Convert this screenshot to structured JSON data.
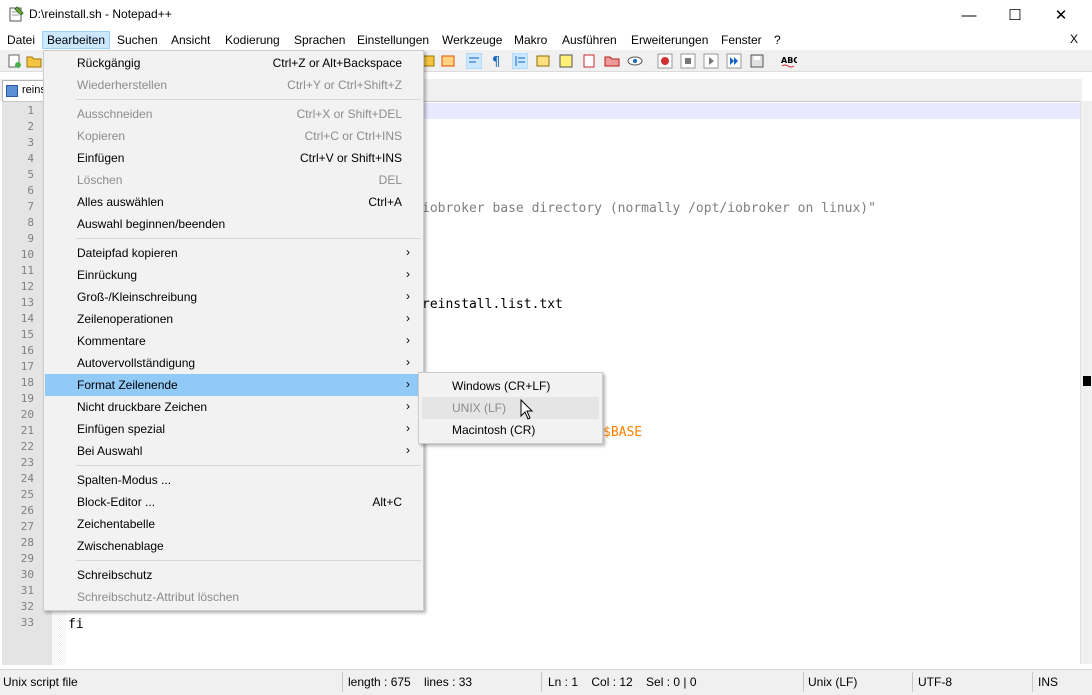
{
  "window": {
    "title": "D:\\reinstall.sh - Notepad++",
    "minimize": "—",
    "maximize": "☐",
    "close": "✕"
  },
  "menubar": {
    "items": [
      "Datei",
      "Bearbeiten",
      "Suchen",
      "Ansicht",
      "Kodierung",
      "Sprachen",
      "Einstellungen",
      "Werkzeuge",
      "Makro",
      "Ausführen",
      "Erweiterungen",
      "Fenster",
      "?"
    ],
    "active": "Bearbeiten",
    "close_doc": "X"
  },
  "tab": {
    "label": "reins"
  },
  "editor": {
    "line_numbers": [
      "1",
      "2",
      "3",
      "4",
      "5",
      "6",
      "7",
      "8",
      "9",
      "10",
      "11",
      "12",
      "13",
      "14",
      "15",
      "16",
      "17",
      "18",
      "19",
      "20",
      "21",
      "22",
      "23",
      "24",
      "25",
      "26",
      "27",
      "28",
      "29",
      "30",
      "31",
      "32",
      "33"
    ],
    "visible_code": {
      "line7": "iobroker base directory (normally /opt/iobroker on linux)\"",
      "line13": "reinstall.list.txt",
      "line21": "$BASE",
      "line33": "fi"
    }
  },
  "edit_menu": {
    "items": [
      {
        "label": "Rückgängig",
        "shortcut": "Ctrl+Z or Alt+Backspace",
        "disabled": false
      },
      {
        "label": "Wiederherstellen",
        "shortcut": "Ctrl+Y or Ctrl+Shift+Z",
        "disabled": true
      },
      {
        "label": "Ausschneiden",
        "shortcut": "Ctrl+X or Shift+DEL",
        "disabled": true
      },
      {
        "label": "Kopieren",
        "shortcut": "Ctrl+C or Ctrl+INS",
        "disabled": true
      },
      {
        "label": "Einfügen",
        "shortcut": "Ctrl+V or Shift+INS",
        "disabled": false
      },
      {
        "label": "Löschen",
        "shortcut": "DEL",
        "disabled": true
      },
      {
        "label": "Alles auswählen",
        "shortcut": "Ctrl+A",
        "disabled": false
      },
      {
        "label": "Auswahl beginnen/beenden",
        "shortcut": "",
        "disabled": false
      },
      {
        "label": "Dateipfad kopieren",
        "submenu": true
      },
      {
        "label": "Einrückung",
        "submenu": true
      },
      {
        "label": "Groß-/Kleinschreibung",
        "submenu": true
      },
      {
        "label": "Zeilenoperationen",
        "submenu": true
      },
      {
        "label": "Kommentare",
        "submenu": true
      },
      {
        "label": "Autovervollständigung",
        "submenu": true
      },
      {
        "label": "Format Zeilenende",
        "submenu": true,
        "highlighted": true
      },
      {
        "label": "Nicht druckbare Zeichen",
        "submenu": true
      },
      {
        "label": "Einfügen spezial",
        "submenu": true
      },
      {
        "label": "Bei Auswahl",
        "submenu": true
      },
      {
        "label": "Spalten-Modus ...",
        "shortcut": ""
      },
      {
        "label": "Block-Editor ...",
        "shortcut": "Alt+C"
      },
      {
        "label": "Zeichentabelle",
        "shortcut": ""
      },
      {
        "label": "Zwischenablage",
        "shortcut": ""
      },
      {
        "label": "Schreibschutz",
        "shortcut": ""
      },
      {
        "label": "Schreibschutz-Attribut löschen",
        "shortcut": "",
        "disabled": true
      }
    ],
    "submenu_arrow": "›"
  },
  "eol_submenu": {
    "items": [
      {
        "label": "Windows (CR+LF)",
        "disabled": false
      },
      {
        "label": "UNIX (LF)",
        "disabled": true,
        "hover": true
      },
      {
        "label": "Macintosh (CR)",
        "disabled": false
      }
    ]
  },
  "statusbar": {
    "filetype": "Unix script file",
    "length": "length : 675    lines : 33",
    "position": "Ln : 1    Col : 12    Sel : 0 | 0",
    "eol": "Unix (LF)",
    "encoding": "UTF-8",
    "mode": "INS"
  },
  "colors": {
    "menu_highlight": "#91c9f7",
    "caret_line": "#e8e8ff",
    "string": "#808080",
    "variable": "#ff8000"
  }
}
